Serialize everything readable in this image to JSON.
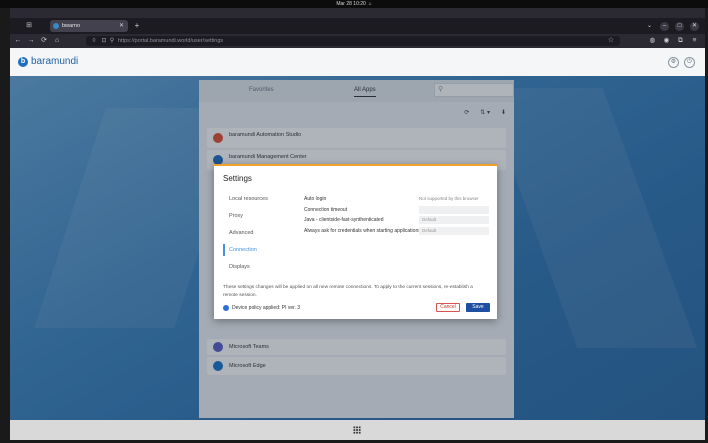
{
  "os": {
    "clock": "Mar 28 10:20",
    "status_icon": "bell-icon"
  },
  "browser": {
    "tab_title": "bwarno",
    "url": "https://portal.baramundi.world/user/settings",
    "nav": {
      "back": "back-arrow-icon",
      "forward": "forward-arrow-icon",
      "reload": "reload-icon",
      "home": "home-icon"
    }
  },
  "app": {
    "brand": "baramundi",
    "brand_color": "#1f6fbf",
    "accent_color": "#f0a028",
    "tabs": [
      "Favorites",
      "All Apps"
    ],
    "search_placeholder": "",
    "tools": [
      "⟳",
      "⇅ ▾",
      "⬇"
    ],
    "items": [
      {
        "title": "baramundi Automation Studio",
        "subtitle": "",
        "color": "#e05030"
      },
      {
        "title": "baramundi Management Center",
        "subtitle": "",
        "color": "#1f6fbf"
      },
      {
        "title": "Microsoft Teams",
        "subtitle": "",
        "color": "#5b5fc7"
      },
      {
        "title": "Microsoft Edge",
        "subtitle": "",
        "color": "#1b74c8"
      }
    ]
  },
  "modal": {
    "title": "Settings",
    "nav": [
      {
        "label": "Local resources",
        "active": false
      },
      {
        "label": "Proxy",
        "active": false
      },
      {
        "label": "Advanced",
        "active": false
      },
      {
        "label": "Connection",
        "active": true
      },
      {
        "label": "Displays",
        "active": false
      }
    ],
    "rows": [
      {
        "label": "Auto login",
        "value": "Not supported by this browser",
        "plain": true
      },
      {
        "label": "Connection timeout",
        "value": "",
        "plain": false
      },
      {
        "label": "Java - clientside-fast-synthenticated",
        "value": "Default",
        "plain": false
      },
      {
        "label": "Always ask for credentials when starting applications",
        "value": "Default",
        "plain": false
      }
    ],
    "note": "These settings changes will be applied on all new remote connections. To apply to the current sessions, re-establish a remote session.",
    "policy_text": "Device policy applied: PI ver. 3",
    "cancel_label": "Cancel",
    "save_label": "Save"
  }
}
